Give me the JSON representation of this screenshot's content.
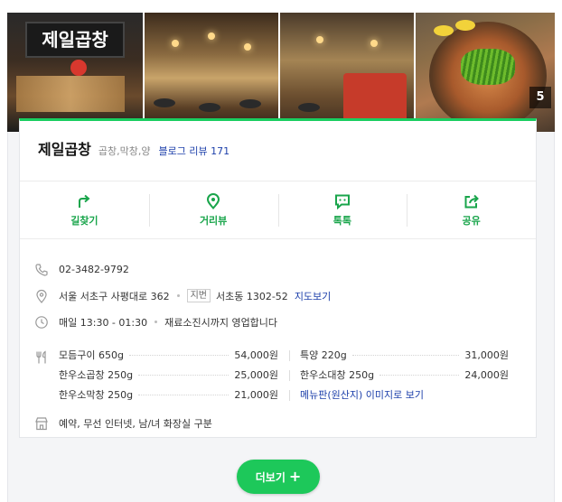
{
  "photos": {
    "sign_text": "제일곱창",
    "count": "5"
  },
  "place": {
    "name": "제일곱창",
    "category": "곱창,막창,양",
    "review_label": "블로그 리뷰",
    "review_count": "171"
  },
  "actions": [
    {
      "label": "길찾기",
      "icon": "route-arrow-icon"
    },
    {
      "label": "거리뷰",
      "icon": "location-pin-icon"
    },
    {
      "label": "톡톡",
      "icon": "chat-icon"
    },
    {
      "label": "공유",
      "icon": "share-icon"
    }
  ],
  "info": {
    "phone": "02-3482-9792",
    "address": "서울 서초구 사평대로 362",
    "jibun_tag": "지번",
    "jibun": "서초동 1302-52",
    "map_link": "지도보기",
    "hours": "매일 13:30 - 01:30",
    "hours_note": "재료소진시까지 영업합니다",
    "facilities": "예약, 무선 인터넷, 남/녀 화장실 구분"
  },
  "menu": [
    {
      "name": "모듬구이 650g",
      "price": "54,000원"
    },
    {
      "name": "특양 220g",
      "price": "31,000원"
    },
    {
      "name": "한우소곱창 250g",
      "price": "25,000원"
    },
    {
      "name": "한우소대창 250g",
      "price": "24,000원"
    },
    {
      "name": "한우소막창 250g",
      "price": "21,000원"
    }
  ],
  "menu_link": "메뉴판(원산지) 이미지로 보기",
  "more_button": "더보기",
  "colors": {
    "accent": "#19ce60",
    "link": "#1c3faa"
  }
}
